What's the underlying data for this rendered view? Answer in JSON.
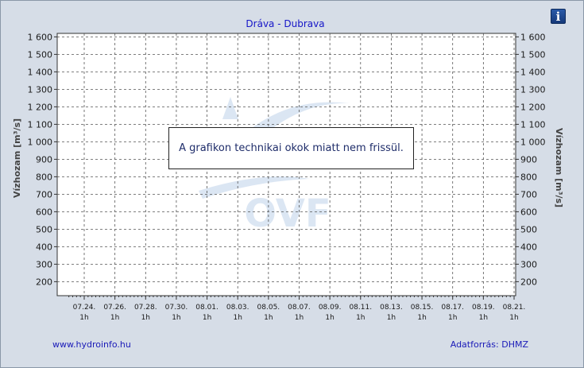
{
  "header": {
    "info_label": "i"
  },
  "notice": {
    "text": "A grafikon technikai okok miatt nem frissül."
  },
  "footer": {
    "link": "www.hydroinfo.hu",
    "source": "Adatforrás: DHMZ"
  },
  "watermark": {
    "text": "OVF"
  },
  "colors": {
    "title": "#1515c8",
    "background": "#d6dde7",
    "plot": "#ffffff",
    "grid": "#555555"
  },
  "chart_data": {
    "type": "line",
    "title": "Dráva - Dubrava",
    "ylabel": "Vízhozam [m³/s]",
    "ylabel_right": "Vízhozam [m³/s]",
    "ylim": [
      120,
      1620
    ],
    "yticks": [
      "1 600",
      "1 500",
      "1 400",
      "1 300",
      "1 200",
      "1 100",
      "1 000",
      "900",
      "800",
      "700",
      "600",
      "500",
      "400",
      "300",
      "200"
    ],
    "ytick_values": [
      1600,
      1500,
      1400,
      1300,
      1200,
      1100,
      1000,
      900,
      800,
      700,
      600,
      500,
      400,
      300,
      200
    ],
    "xticks": [
      "07.24.",
      "07.26.",
      "07.28.",
      "07.30.",
      "08.01.",
      "08.03.",
      "08.05.",
      "08.07.",
      "08.09.",
      "08.11.",
      "08.13.",
      "08.15.",
      "08.17.",
      "08.19.",
      "08.21."
    ],
    "xtick_sub": "1h",
    "grid": true,
    "series": []
  }
}
